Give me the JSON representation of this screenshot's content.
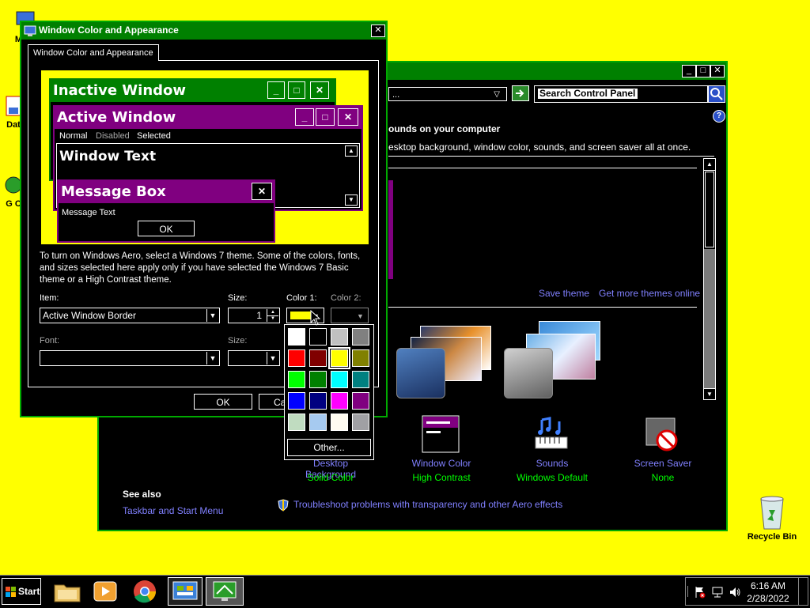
{
  "desktop": {
    "icons": [
      {
        "label": "My C"
      },
      {
        "label": "Dat"
      },
      {
        "label": "G C"
      },
      {
        "label": "Recycle Bin"
      }
    ]
  },
  "cp_window": {
    "address_text": "...",
    "search_placeholder": "Search Control Panel",
    "help_glyph": "?",
    "heading": "ounds on your computer",
    "subheading": "esktop background, window color, sounds, and screen saver all at once.",
    "save_theme": "Save theme",
    "get_more_themes": "Get more themes online",
    "bottom_items": [
      {
        "label": "Desktop Background",
        "value": "Solid Color"
      },
      {
        "label": "Window Color",
        "value": "High Contrast"
      },
      {
        "label": "Sounds",
        "value": "Windows Default"
      },
      {
        "label": "Screen Saver",
        "value": "None"
      }
    ],
    "see_also": "See also",
    "taskbar_link": "Taskbar and Start Menu",
    "troubleshoot": "Troubleshoot problems with transparency and other Aero effects"
  },
  "dialog": {
    "title": "Window Color and Appearance",
    "tab": "Window Color and Appearance",
    "preview": {
      "inactive_title": "Inactive Window",
      "active_title": "Active Window",
      "menu_normal": "Normal",
      "menu_disabled": "Disabled",
      "menu_selected": "Selected",
      "window_text": "Window Text",
      "msgbox_title": "Message Box",
      "msgbox_text": "Message Text",
      "msgbox_ok": "OK"
    },
    "info_text": "To turn on Windows Aero, select a Windows 7 theme.  Some of the colors, fonts, and sizes selected here apply only if you have selected the Windows 7 Basic theme or a High Contrast theme.",
    "item_label": "Item:",
    "item_value": "Active Window Border",
    "size_label": "Size:",
    "size_value": "1",
    "color1_label": "Color 1:",
    "color2_label": "Color 2:",
    "font_label": "Font:",
    "font_size_label": "Size:",
    "ok": "OK",
    "cancel": "Ca"
  },
  "color_picker": {
    "swatches": [
      "#ffffff",
      "#000000",
      "#c0c0c0",
      "#808080",
      "#ff0000",
      "#800000",
      "#ffff00",
      "#808000",
      "#00ff00",
      "#008000",
      "#00ffff",
      "#008080",
      "#0000ff",
      "#000080",
      "#ff00ff",
      "#800080",
      "#c0dcc0",
      "#a6caf0",
      "#fffbf0",
      "#a0a0a4"
    ],
    "selected_index": 6,
    "other_button": "Other..."
  },
  "taskbar": {
    "start": "Start",
    "time": "6:16 AM",
    "date": "2/28/2022"
  }
}
